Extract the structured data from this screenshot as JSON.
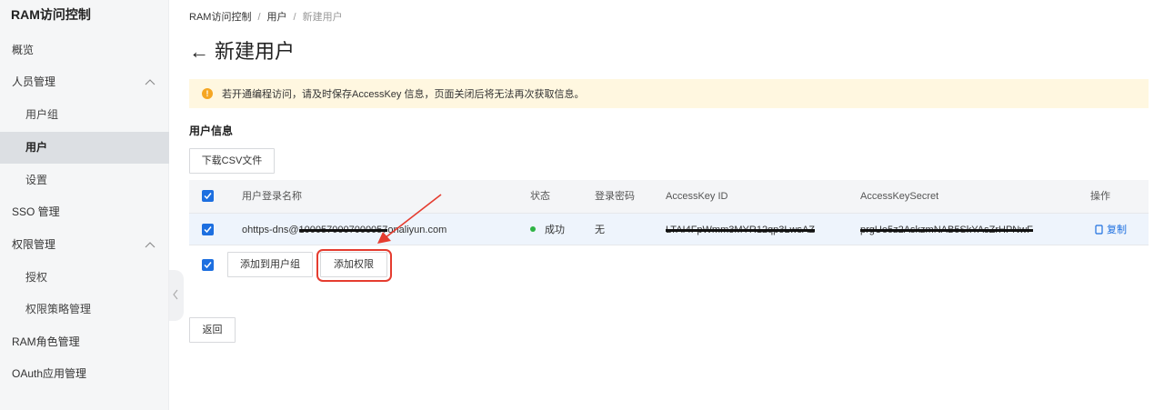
{
  "sidebar": {
    "title": "RAM访问控制",
    "items": [
      {
        "label": "概览"
      },
      {
        "label": "人员管理"
      },
      {
        "label": "用户组"
      },
      {
        "label": "用户"
      },
      {
        "label": "设置"
      },
      {
        "label": "SSO 管理"
      },
      {
        "label": "权限管理"
      },
      {
        "label": "授权"
      },
      {
        "label": "权限策略管理"
      },
      {
        "label": "RAM角色管理"
      },
      {
        "label": "OAuth应用管理"
      }
    ],
    "active": "用户"
  },
  "breadcrumb": {
    "items": [
      "RAM访问控制",
      "用户",
      "新建用户"
    ],
    "separator": "/"
  },
  "page": {
    "back_icon": "←",
    "title": "新建用户"
  },
  "alert": {
    "icon": "!",
    "text": "若开通编程访问，请及时保存AccessKey 信息，页面关闭后将无法再次获取信息。",
    "color": "#fff7e0"
  },
  "section": {
    "title": "用户信息",
    "download_label": "下载CSV文件"
  },
  "table": {
    "columns": [
      "用户登录名称",
      "状态",
      "登录密码",
      "AccessKey ID",
      "AccessKeySecret",
      "操作"
    ],
    "rows": [
      {
        "login_prefix": "ohttps-dns@",
        "login_redacted": "1000570007000057",
        "login_suffix": "onaliyun.com",
        "status": "成功",
        "password": "无",
        "access_key_id": "LTAI4FpWmm3MYR12qp3LwsAZ",
        "access_key_secret": "prgUe5z2AskzmNAB5SkYAsZrHPNwF",
        "action": "复制"
      }
    ]
  },
  "bulk_actions": {
    "add_to_group": "添加到用户组",
    "add_permission": "添加权限"
  },
  "footer": {
    "return_label": "返回"
  },
  "colors": {
    "accent": "#1d6fe0",
    "success": "#2fb344",
    "annotation": "#e53c2f"
  }
}
